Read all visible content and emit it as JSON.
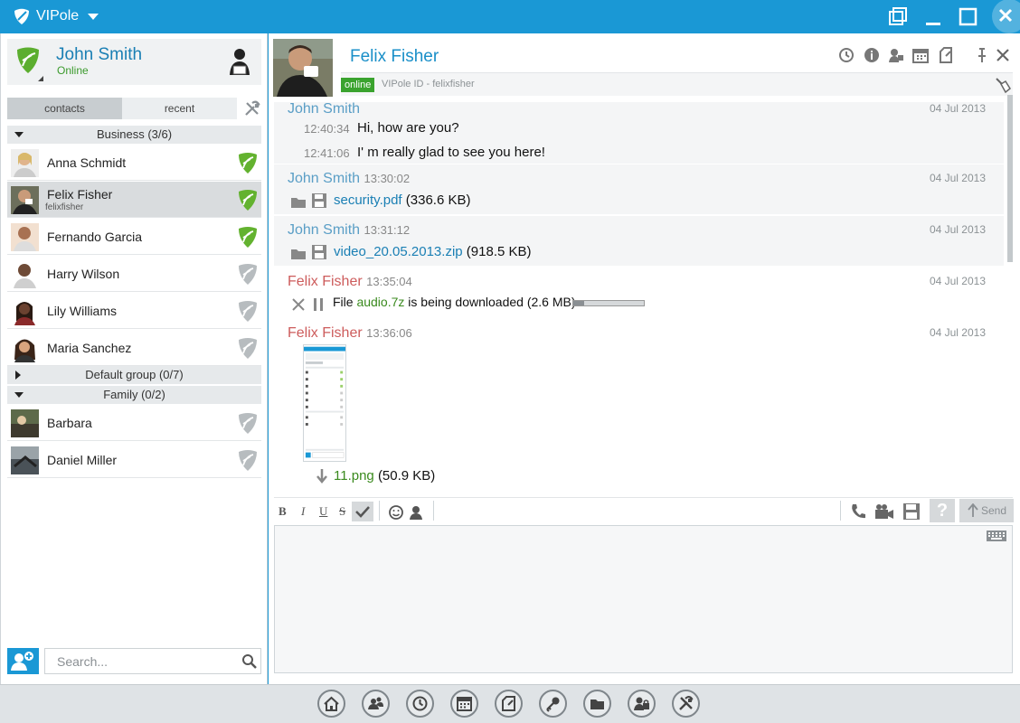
{
  "app": {
    "title": "VIPole"
  },
  "profile": {
    "name": "John Smith",
    "status": "Online"
  },
  "tabs": {
    "contacts": "contacts",
    "recent": "recent"
  },
  "groups": [
    {
      "label": "Business (3/6)"
    },
    {
      "label": "Default group (0/7)"
    },
    {
      "label": "Family (0/2)"
    }
  ],
  "contacts": [
    {
      "name": "Anna Schmidt",
      "online": true
    },
    {
      "name": "Felix Fisher",
      "sub": "felixfisher",
      "online": true,
      "selected": true
    },
    {
      "name": "Fernando Garcia",
      "online": true
    },
    {
      "name": "Harry Wilson",
      "online": false
    },
    {
      "name": "Lily Williams",
      "online": false
    },
    {
      "name": "Maria Sanchez",
      "online": false
    },
    {
      "name": "Barbara",
      "online": false
    },
    {
      "name": "Daniel Miller",
      "online": false
    }
  ],
  "search": {
    "placeholder": "Search..."
  },
  "chat": {
    "name": "Felix Fisher",
    "status_badge": "online",
    "vipole_id": "VIPole ID - felixfisher"
  },
  "messages": [
    {
      "author": "John Smith",
      "date": "04 Jul 2013",
      "lines": [
        {
          "time": "12:40:34",
          "text": "Hi, how are you?"
        },
        {
          "time": "12:41:06",
          "text": "I' m really glad to see you here!"
        }
      ]
    },
    {
      "author": "John Smith",
      "time": "13:30:02",
      "date": "04 Jul 2013",
      "file": "security.pdf",
      "size": "(336.6 KB)"
    },
    {
      "author": "John Smith",
      "time": "13:31:12",
      "date": "04 Jul 2013",
      "file": "video_20.05.2013.zip",
      "size": "(918.5 KB)"
    },
    {
      "author": "Felix Fisher",
      "time": "13:35:04",
      "date": "04 Jul 2013",
      "download": {
        "prefix": "File",
        "file": "audio.7z",
        "suffix": "is being downloaded (2.6 MB)",
        "progress": 0.15
      }
    },
    {
      "author": "Felix Fisher",
      "time": "13:36:06",
      "date": "04 Jul 2013",
      "image_file": "11.png",
      "size": "(50.9 KB)"
    }
  ],
  "composer": {
    "bold": "B",
    "italic": "I",
    "underline": "U",
    "strike": "S",
    "help": "?",
    "send": "Send"
  },
  "colors": {
    "brand": "#1a98d5",
    "online": "#3aa32e",
    "me": "#5a9ec6",
    "them": "#cd5c5c"
  }
}
